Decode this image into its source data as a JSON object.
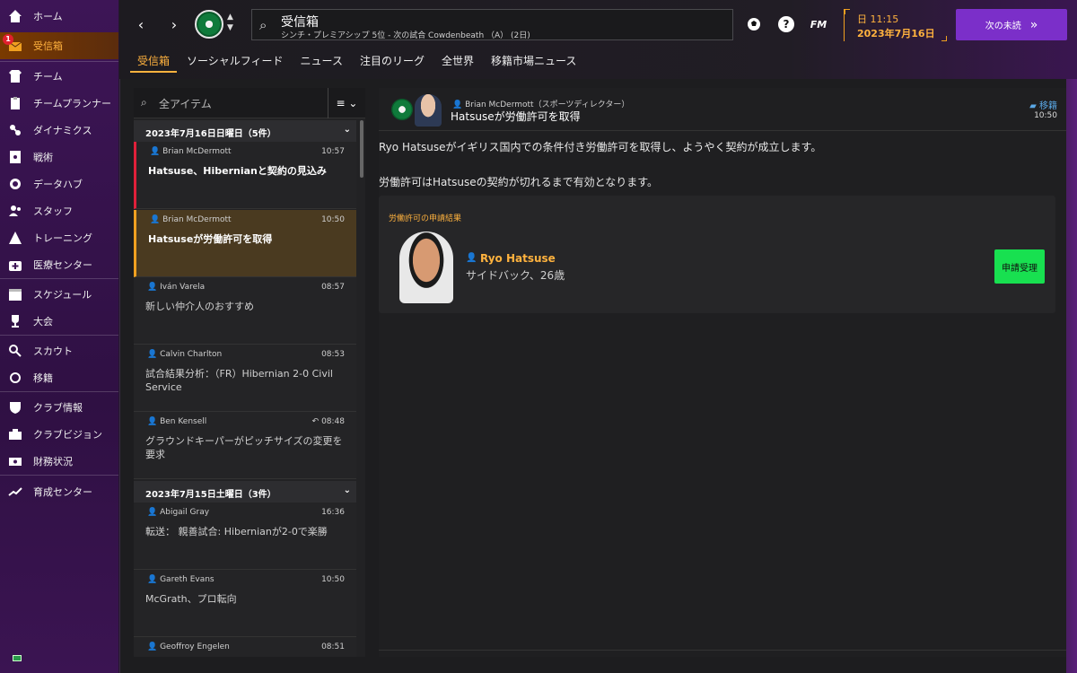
{
  "sidebar": {
    "badge_count": "1",
    "items": [
      {
        "label": "ホーム",
        "icon": "home-icon"
      },
      {
        "label": "受信箱",
        "icon": "inbox-icon"
      },
      {
        "label": "チーム",
        "icon": "team-icon"
      },
      {
        "label": "チームプランナー",
        "icon": "clipboard-icon"
      },
      {
        "label": "ダイナミクス",
        "icon": "dynamics-icon"
      },
      {
        "label": "戦術",
        "icon": "tactics-icon"
      },
      {
        "label": "データハブ",
        "icon": "data-hub-icon"
      },
      {
        "label": "スタッフ",
        "icon": "staff-icon"
      },
      {
        "label": "トレーニング",
        "icon": "training-icon"
      },
      {
        "label": "医療センター",
        "icon": "medical-icon"
      },
      {
        "label": "スケジュール",
        "icon": "calendar-icon"
      },
      {
        "label": "大会",
        "icon": "trophy-icon"
      },
      {
        "label": "スカウト",
        "icon": "scout-icon"
      },
      {
        "label": "移籍",
        "icon": "transfer-icon"
      },
      {
        "label": "クラブ情報",
        "icon": "club-icon"
      },
      {
        "label": "クラブビジョン",
        "icon": "vision-icon"
      },
      {
        "label": "財務状況",
        "icon": "finance-icon"
      },
      {
        "label": "育成センター",
        "icon": "development-icon"
      }
    ]
  },
  "header": {
    "title": "受信箱",
    "subtitle": "シンチ・プレミアシップ 5位 - 次の試合 Cowdenbeath （A） (2日)",
    "fm_label": "FM",
    "help_label": "?",
    "date_line1": "日 11:15",
    "date_line2": "2023年7月16日",
    "continue_label": "次の未読",
    "continue_arrow": "»"
  },
  "tabs": [
    "受信箱",
    "ソーシャルフィード",
    "ニュース",
    "注目のリーグ",
    "全世界",
    "移籍市場ニュース"
  ],
  "filter": {
    "placeholder": "全アイテム"
  },
  "groups": [
    {
      "label": "2023年7月16日日曜日（5件）"
    },
    {
      "label": "2023年7月15日土曜日（3件）"
    }
  ],
  "messages": [
    {
      "sender": "Brian McDermott",
      "time": "10:57",
      "subject": "Hatsuse、Hibernianと契約の見込み"
    },
    {
      "sender": "Brian McDermott",
      "time": "10:50",
      "subject": "Hatsuseが労働許可を取得"
    },
    {
      "sender": "Iván Varela",
      "time": "08:57",
      "subject": "新しい仲介人のおすすめ"
    },
    {
      "sender": "Calvin Charlton",
      "time": "08:53",
      "subject": "試合結果分析：（FR）Hibernian 2-0 Civil Service"
    },
    {
      "sender": "Ben Kensell",
      "time": "08:48",
      "subject": "グラウンドキーパーがピッチサイズの変更を要求"
    },
    {
      "sender": "Abigail Gray",
      "time": "16:36",
      "subject": "転送： 親善試合: Hibernianが2-0で楽勝"
    },
    {
      "sender": "Gareth Evans",
      "time": "10:50",
      "subject": "McGrath、プロ転向"
    },
    {
      "sender": "Geoffroy Engelen",
      "time": "08:51",
      "subject": ""
    }
  ],
  "detail": {
    "from": "Brian McDermott（スポーツディレクター）",
    "subject": "Hatsuseが労働許可を取得",
    "tag": "移籍",
    "time": "10:50",
    "para1": "Ryo Hatsuseがイギリス国内での条件付き労働許可を取得し、ようやく契約が成立します。",
    "para2": "労働許可はHatsuseの契約が切れるまで有効となります。",
    "card_title": "労働許可の申請結果",
    "player_name": "Ryo Hatsuse",
    "player_position": "サイドバック、26歳",
    "accept_label": "申請受理"
  },
  "colors": {
    "accent": "#ffb23e",
    "brand_purple": "#7b2fc9",
    "accept_green": "#18e050",
    "unread_red": "#e0203a"
  }
}
